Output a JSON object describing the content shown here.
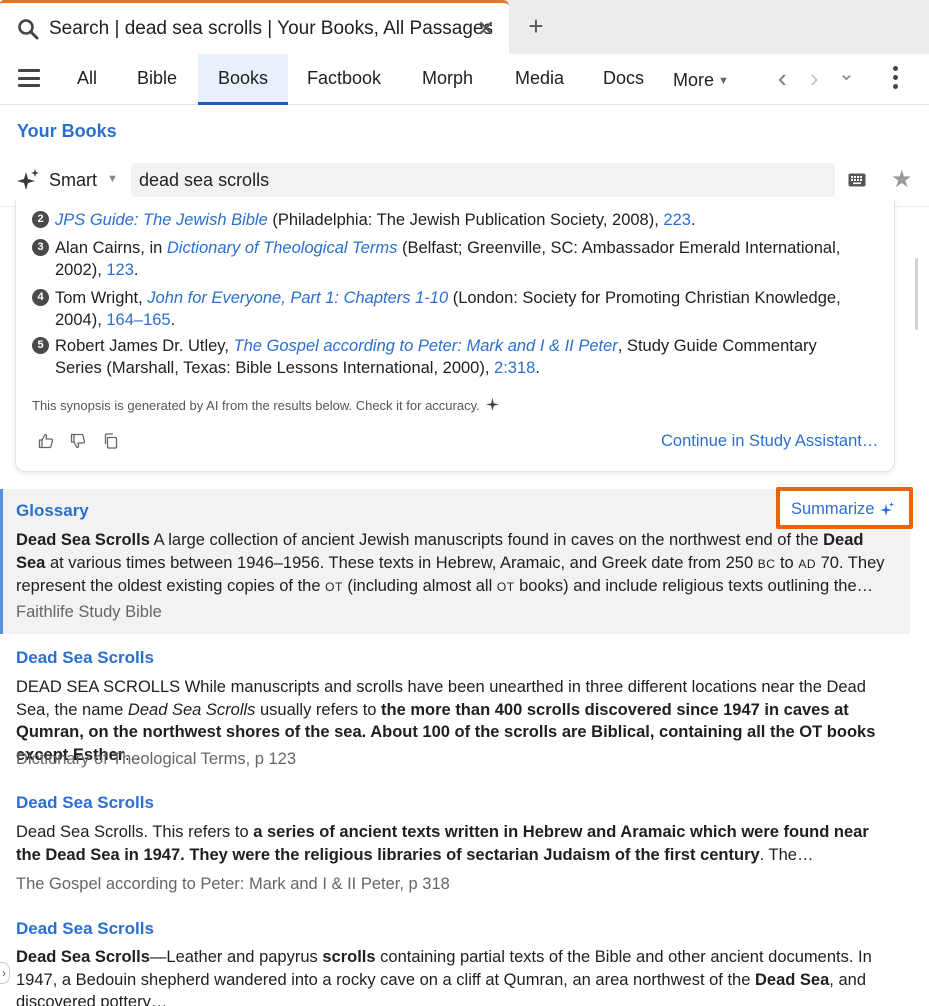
{
  "tab": {
    "title": "Search | dead sea scrolls | Your Books, All Passages",
    "close_glyph": "✕",
    "new_glyph": "+",
    "search_icon": "search-icon"
  },
  "nav": {
    "tabs": [
      {
        "label": "All"
      },
      {
        "label": "Bible"
      },
      {
        "label": "Books",
        "active": true
      },
      {
        "label": "Factbook"
      },
      {
        "label": "Morph"
      },
      {
        "label": "Media"
      },
      {
        "label": "Docs"
      },
      {
        "label": "More"
      }
    ],
    "back_glyph": "‹",
    "forward_glyph": "›",
    "history_glyph": "⌄"
  },
  "search": {
    "scope_label": "Your Books",
    "mode_label": "Smart",
    "query": "dead sea scrolls"
  },
  "synopsis": {
    "references": [
      {
        "num": "2",
        "pre": "",
        "title": "JPS Guide: The Jewish Bible",
        "mid": " (Philadelphia: The Jewish Publication Society, 2008), ",
        "page": "223",
        "post": "."
      },
      {
        "num": "3",
        "pre": "Alan Cairns, in ",
        "title": "Dictionary of Theological Terms",
        "mid": " (Belfast; Greenville, SC: Ambassador Emerald International, 2002), ",
        "page": "123",
        "post": "."
      },
      {
        "num": "4",
        "pre": "Tom Wright, ",
        "title": "John for Everyone, Part 1: Chapters 1-10",
        "mid": " (London: Society for Promoting Christian Knowledge, 2004), ",
        "page": "164–165",
        "post": "."
      },
      {
        "num": "5",
        "pre": "Robert James Dr. Utley, ",
        "title": "The Gospel according to Peter: Mark and I & II Peter",
        "mid": ", Study Guide Commentary Series (Marshall, Texas: Bible Lessons International, 2000), ",
        "page": "2:318",
        "post": "."
      }
    ],
    "ai_note": "This synopsis is generated by AI from the results below. Check it for accuracy.",
    "continue_label": "Continue in Study Assistant…"
  },
  "results": {
    "glossary": {
      "title": "Glossary",
      "summarize_label": "Summarize",
      "head": "Dead Sea Scrolls",
      "t1": " A large collection of ancient Jewish manuscripts found in caves on the northwest end of the ",
      "bold2": "Dead Sea",
      "t2": " at various times between 1946–1956. These texts in Hebrew, Aramaic, and Greek date from 250 ",
      "bc": "BC",
      "t3": " to ",
      "ad": "AD",
      "t4": " 70. They represent the oldest existing copies of the ",
      "ot1": "OT",
      "t5": " (including almost all ",
      "ot2": "OT",
      "t6": " books) and include religious texts outlining the…",
      "source": "Faithlife Study Bible"
    },
    "r1": {
      "title": "Dead Sea Scrolls",
      "t1": "DEAD SEA SCROLLS While manuscripts and scrolls have been unearthed in three different locations near the Dead Sea, the name ",
      "ital": "Dead Sea Scrolls",
      "t2": " usually refers to ",
      "bold": "the more than 400 scrolls discovered since 1947 in caves at Qumran, on the northwest shores of the sea. About 100 of the scrolls are Biblical, containing all the OT books except Esther",
      "t3": "…",
      "source": "Dictionary of Theological Terms, p 123"
    },
    "r2": {
      "title": "Dead Sea Scrolls",
      "t1": "Dead Sea Scrolls. This refers to ",
      "bold": "a series of ancient texts written in Hebrew and Aramaic which were found near the Dead Sea in 1947. They were the religious libraries of sectarian Judaism of the first century",
      "t2": ". The…",
      "source": "The Gospel according to Peter: Mark and I & II Peter, p 318"
    },
    "r3": {
      "title": "Dead Sea Scrolls",
      "bold1": "Dead Sea Scrolls",
      "t1": "—Leather and papyrus ",
      "bold2": "scrolls",
      "t2": " containing partial texts of the Bible and other ancient documents. In 1947, a Bedouin shepherd wandered into a rocky cave on a cliff at Qumran, an area northwest of the ",
      "bold3": "Dead Sea",
      "t3": ", and discovered pottery…"
    }
  }
}
